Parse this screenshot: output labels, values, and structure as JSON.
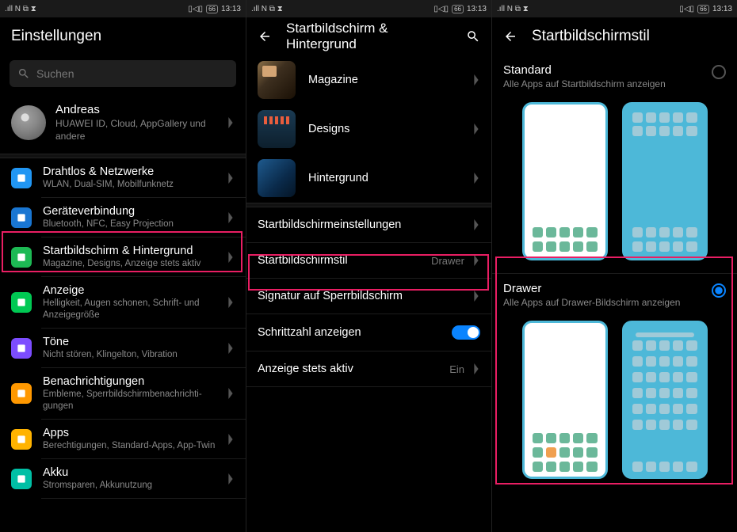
{
  "status": {
    "left": ".ıll   N ⧉ ⧗",
    "vibrate": "▯◁▯",
    "battery": "66",
    "time": "13:13"
  },
  "p1": {
    "title": "Einstellungen",
    "search_placeholder": "Suchen",
    "profile": {
      "name": "Andreas",
      "sub": "HUAWEI ID, Cloud, AppGallery und andere"
    },
    "items": [
      {
        "title": "Drahtlos & Netzwerke",
        "sub": "WLAN, Dual-SIM, Mobilfunknetz",
        "color": "#2196f3"
      },
      {
        "title": "Geräteverbindung",
        "sub": "Bluetooth, NFC, Easy Projection",
        "color": "#1976d2"
      },
      {
        "title": "Startbildschirm & Hintergrund",
        "sub": "Magazine, Designs, Anzeige stets aktiv",
        "color": "#1db954"
      },
      {
        "title": "Anzeige",
        "sub": "Helligkeit, Augen schonen, Schrift- und Anzeigegröße",
        "color": "#00c853"
      },
      {
        "title": "Töne",
        "sub": "Nicht stören, Klingelton, Vibration",
        "color": "#7c4dff"
      },
      {
        "title": "Benachrichtigungen",
        "sub": "Embleme, Sperrbildschirmbenachrichti-gungen",
        "color": "#ff9800"
      },
      {
        "title": "Apps",
        "sub": "Berechtigungen, Standard-Apps, App-Twin",
        "color": "#ffb300"
      },
      {
        "title": "Akku",
        "sub": "Stromsparen, Akkunutzung",
        "color": "#00bfa5"
      }
    ]
  },
  "p2": {
    "title": "Startbildschirm & Hintergrund",
    "thumbs": [
      {
        "label": "Magazine"
      },
      {
        "label": "Designs"
      },
      {
        "label": "Hintergrund"
      }
    ],
    "rows": [
      {
        "label": "Startbildschirmeinstellungen",
        "val": ""
      },
      {
        "label": "Startbildschirmstil",
        "val": "Drawer"
      },
      {
        "label": "Signatur auf Sperrbildschirm",
        "val": ""
      },
      {
        "label": "Schrittzahl anzeigen",
        "val": "__toggle"
      },
      {
        "label": "Anzeige stets aktiv",
        "val": "Ein"
      }
    ]
  },
  "p3": {
    "title": "Startbildschirmstil",
    "opts": [
      {
        "title": "Standard",
        "sub": "Alle Apps auf Startbildschirm anzeigen",
        "selected": false
      },
      {
        "title": "Drawer",
        "sub": "Alle Apps auf Drawer-Bildschirm anzeigen",
        "selected": true
      }
    ]
  }
}
